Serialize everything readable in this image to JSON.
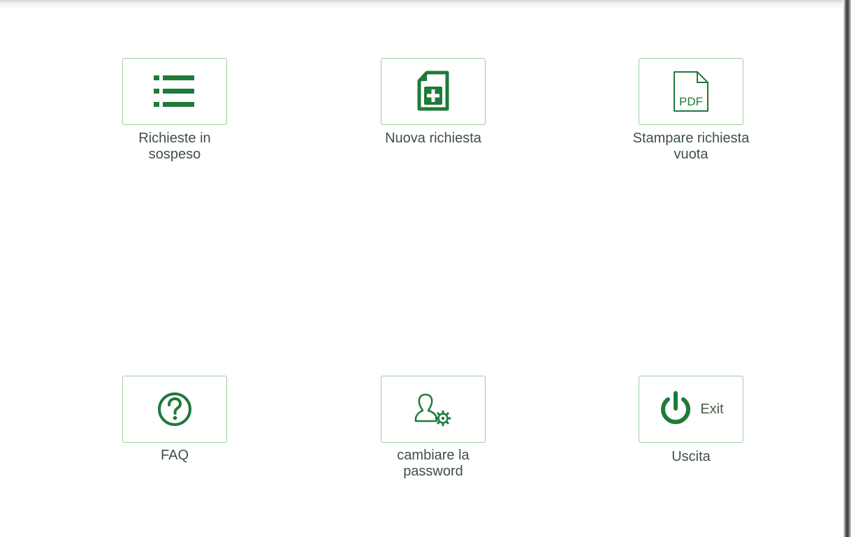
{
  "tiles": [
    {
      "label": "Richieste in sospeso",
      "icon": "list-icon"
    },
    {
      "label": "Nuova richiesta",
      "icon": "new-document-icon"
    },
    {
      "label": "Stampare richiesta vuota",
      "icon": "pdf-icon",
      "icon_text": "PDF"
    },
    {
      "label": "FAQ",
      "icon": "help-icon"
    },
    {
      "label": "cambiare la password",
      "icon": "user-settings-icon"
    },
    {
      "label": "Uscita",
      "icon": "power-icon",
      "icon_text": "Exit"
    }
  ],
  "colors": {
    "accent": "#1f7a3a",
    "border": "#9ccf9c",
    "label": "#3f5141"
  }
}
